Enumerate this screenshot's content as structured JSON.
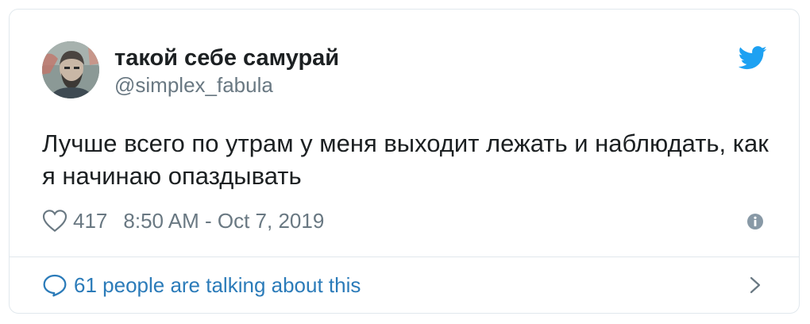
{
  "tweet": {
    "author": {
      "display_name": "такой себе самурай",
      "handle": "@simplex_fabula",
      "avatar": "avatar-image"
    },
    "text": "Лучше всего по утрам у меня выходит лежать и наблюдать, как я начинаю опаздывать",
    "likes": "417",
    "timestamp": "8:50 AM - Oct 7, 2019",
    "footer_text": "61 people are talking about this"
  },
  "icons": {
    "brand": "twitter-bird-icon",
    "like": "heart-icon",
    "info": "info-icon",
    "conversation": "speech-bubble-icon",
    "chevron": "chevron-right-icon"
  },
  "colors": {
    "twitter_blue": "#1da1f2",
    "link_blue": "#2b7bb9",
    "secondary_text": "#697882",
    "primary_text": "#1c2022",
    "border": "#e1e8ed"
  }
}
